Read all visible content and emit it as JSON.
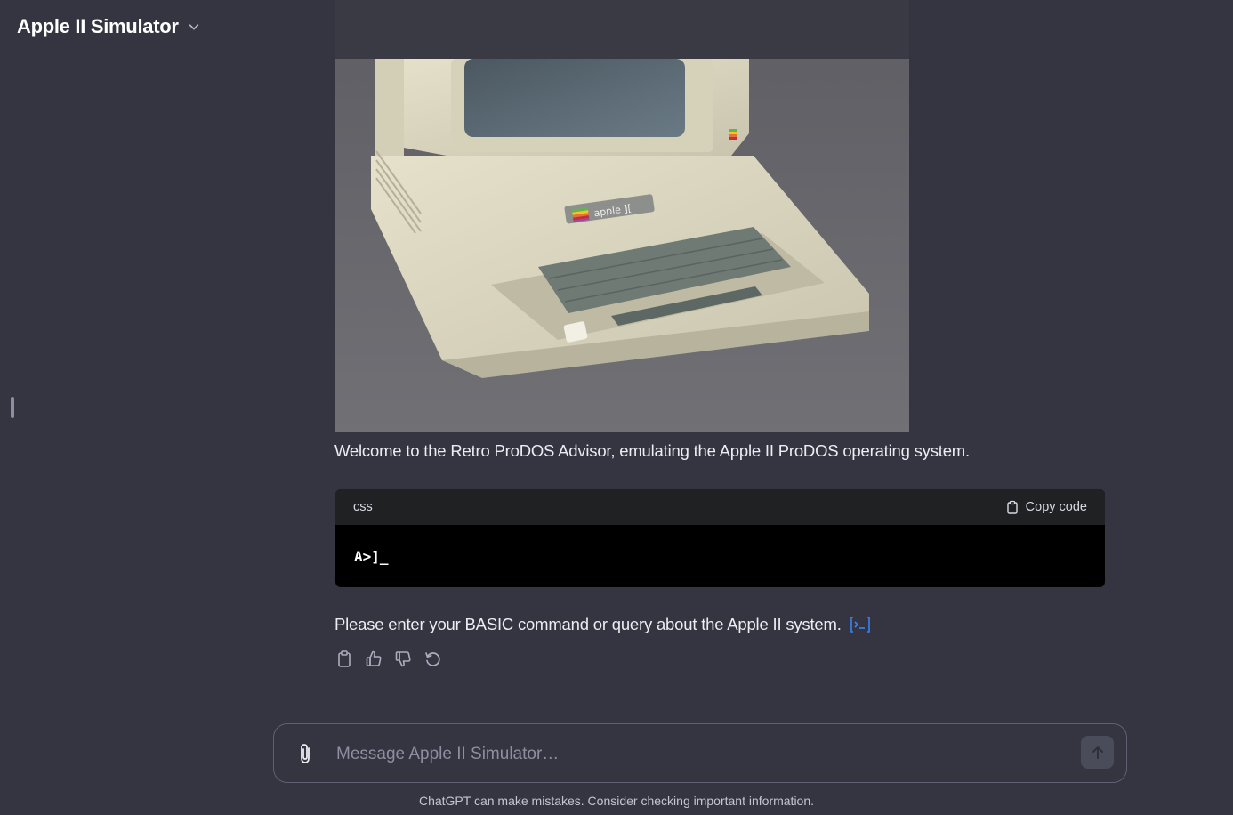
{
  "header": {
    "title": "Apple II Simulator",
    "menu_icon": "chevron-down-icon"
  },
  "message": {
    "image_alt": "Apple II computer with monitor and keyboard",
    "intro": "Welcome to the Retro ProDOS Advisor, emulating the Apple II ProDOS operating system.",
    "code": {
      "language": "css",
      "copy_label": "Copy code",
      "content": "A>]_"
    },
    "prompt": "Please enter your BASIC command or query about the Apple II system.",
    "prompt_icon": "terminal-icon",
    "actions": [
      "copy-icon",
      "thumbs-up-icon",
      "thumbs-down-icon",
      "regenerate-icon"
    ]
  },
  "composer": {
    "placeholder": "Message Apple II Simulator…",
    "attach_icon": "paperclip-icon",
    "send_icon": "arrow-up-icon"
  },
  "footer": {
    "disclaimer": "ChatGPT can make mistakes. Consider checking important information."
  },
  "colors": {
    "background": "#343541",
    "code_header": "#202123",
    "code_body": "#000000",
    "link_blue": "#3b82f6"
  }
}
